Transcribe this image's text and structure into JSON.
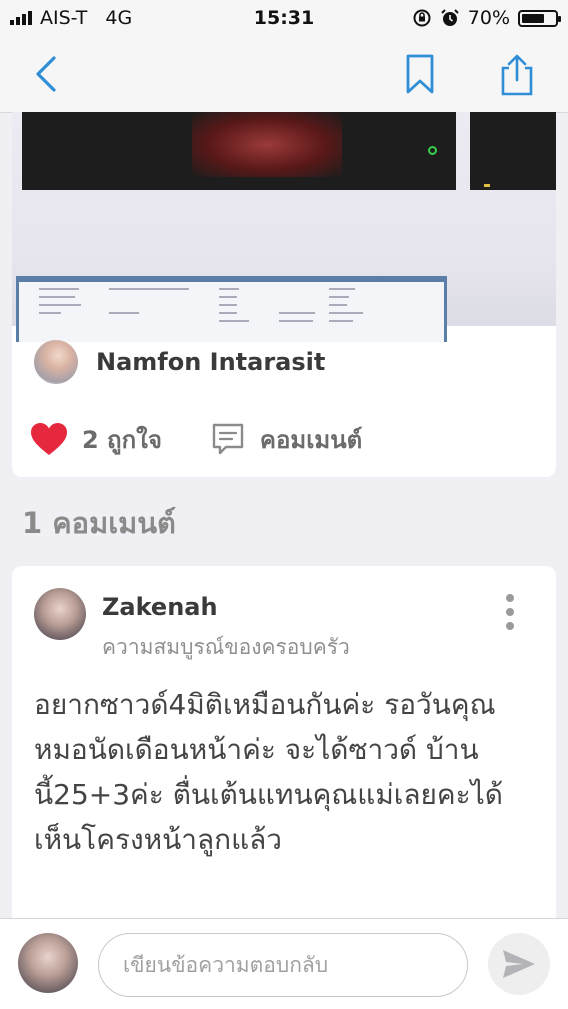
{
  "status_bar": {
    "carrier": "AIS-T",
    "network": "4G",
    "time": "15:31",
    "battery": "70%",
    "battery_level": 0.7
  },
  "nav": {
    "back_icon": "chevron-left-icon",
    "bookmark_icon": "bookmark-icon",
    "share_icon": "share-icon",
    "accent_color": "#2f8ed6"
  },
  "post": {
    "author_name": "Namfon Intarasit",
    "like_label": "2 ถูกใจ",
    "comment_label": "คอมเมนต์",
    "like_color": "#e5283e"
  },
  "comments": {
    "count_label": "1 คอมเมนต์",
    "items": [
      {
        "name": "Zakenah",
        "subtitle": "ความสมบูรณ์ของครอบครัว",
        "text": "อยากซาวด์4มิติเหมือนกันค่ะ รอวันคุณหมอนัดเดือนหน้าค่ะ จะได้ซาวด์ บ้านนี้25+3ค่ะ  ตื่นเต้นแทนคุณแม่เลยคะได้เห็นโครงหน้าลูกแล้ว"
      }
    ]
  },
  "reply": {
    "placeholder": "เขียนข้อความตอบกลับ"
  }
}
